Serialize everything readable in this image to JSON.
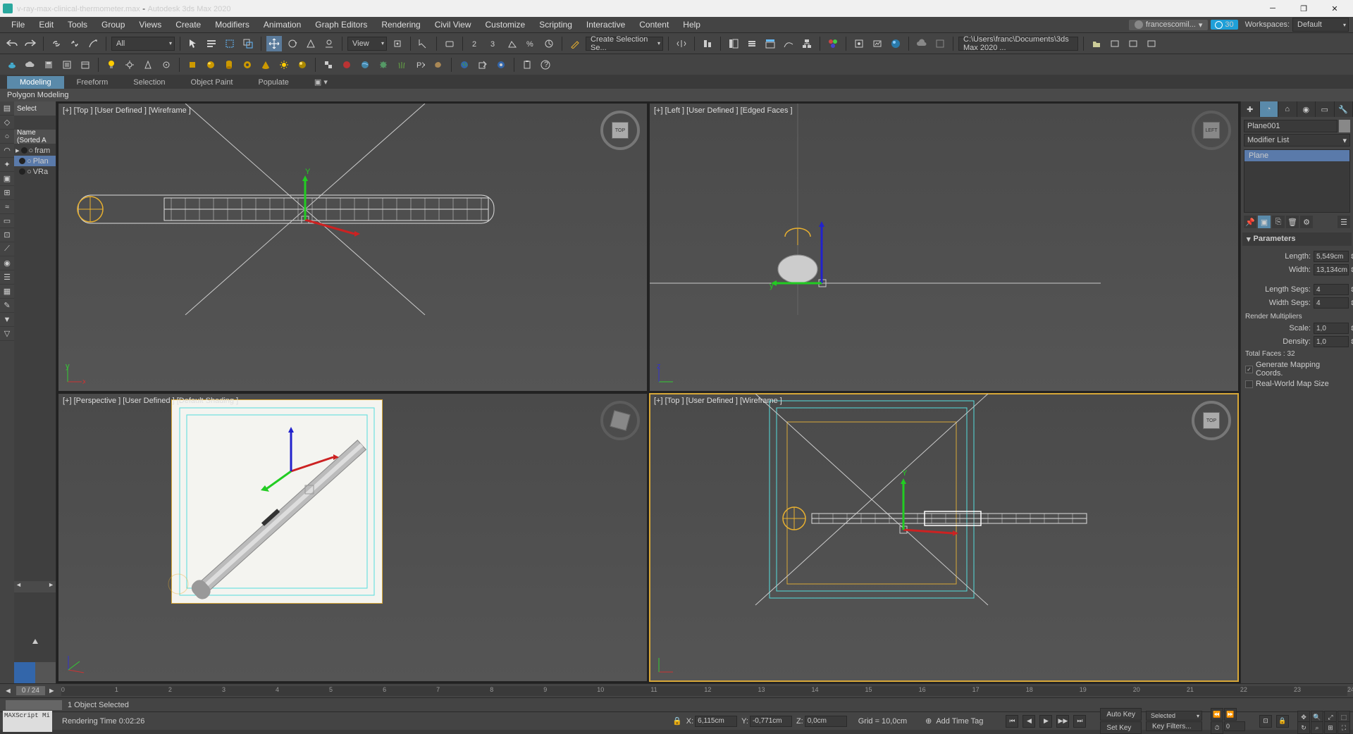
{
  "titlebar": {
    "filename": "v-ray-max-clinical-thermometer.max",
    "app": "Autodesk 3ds Max 2020"
  },
  "menubar": {
    "items": [
      "File",
      "Edit",
      "Tools",
      "Group",
      "Views",
      "Create",
      "Modifiers",
      "Animation",
      "Graph Editors",
      "Rendering",
      "Civil View",
      "Customize",
      "Scripting",
      "Interactive",
      "Content",
      "Help"
    ],
    "user": "francescomil...",
    "badge": "30",
    "workspaces_label": "Workspaces:",
    "workspaces_value": "Default"
  },
  "toolbar1": {
    "filter": "All",
    "view_dd": "View",
    "sel_dd": "Create Selection Se...",
    "path": "C:\\Users\\franc\\Documents\\3ds Max 2020 ..."
  },
  "ribbon": {
    "tabs": [
      "Modeling",
      "Freeform",
      "Selection",
      "Object Paint",
      "Populate"
    ],
    "sub": "Polygon Modeling"
  },
  "scene": {
    "select": "Select",
    "header": "Name (Sorted A",
    "items": [
      "fram",
      "Plan",
      "VRa"
    ],
    "sel_index": 1
  },
  "viewports": {
    "tl": "[+] [Top ] [User Defined ] [Wireframe ]",
    "tr": "[+] [Left ] [User Defined ] [Edged Faces ]",
    "bl": "[+] [Perspective ] [User Defined ] [Default Shading ]",
    "br": "[+] [Top ] [User Defined ] [Wireframe ]",
    "cube_tl": "TOP",
    "cube_tr": "LEFT"
  },
  "cmdpanel": {
    "obj_name": "Plane001",
    "mod_list_label": "Modifier List",
    "mod_item": "Plane",
    "rollout_params": "Parameters",
    "length_label": "Length:",
    "length_val": "5,549cm",
    "width_label": "Width:",
    "width_val": "13,134cm",
    "lsegs_label": "Length Segs:",
    "lsegs_val": "4",
    "wsegs_label": "Width Segs:",
    "wsegs_val": "4",
    "render_mult": "Render Multipliers",
    "scale_label": "Scale:",
    "scale_val": "1,0",
    "density_label": "Density:",
    "density_val": "1,0",
    "total_faces": "Total Faces : 32",
    "gen_mapping": "Generate Mapping Coords.",
    "real_world": "Real-World Map Size"
  },
  "timeline": {
    "frame": "0 / 24",
    "ticks": [
      "0",
      "1",
      "2",
      "3",
      "4",
      "5",
      "6",
      "7",
      "8",
      "9",
      "10",
      "11",
      "12",
      "13",
      "14",
      "15",
      "16",
      "17",
      "18",
      "19",
      "20",
      "21",
      "22",
      "23",
      "24"
    ]
  },
  "status": {
    "sel": "1 Object Selected",
    "render_time": "Rendering Time  0:02:26",
    "script": "MAXScript Mi",
    "x_label": "X:",
    "x_val": "6,115cm",
    "y_label": "Y:",
    "y_val": "-0,771cm",
    "z_label": "Z:",
    "z_val": "0,0cm",
    "grid": "Grid = 10,0cm",
    "add_tag": "Add Time Tag",
    "autokey": "Auto Key",
    "setkey": "Set Key",
    "selected": "Selected",
    "keyfilters": "Key Filters...",
    "frame_input": "0"
  }
}
